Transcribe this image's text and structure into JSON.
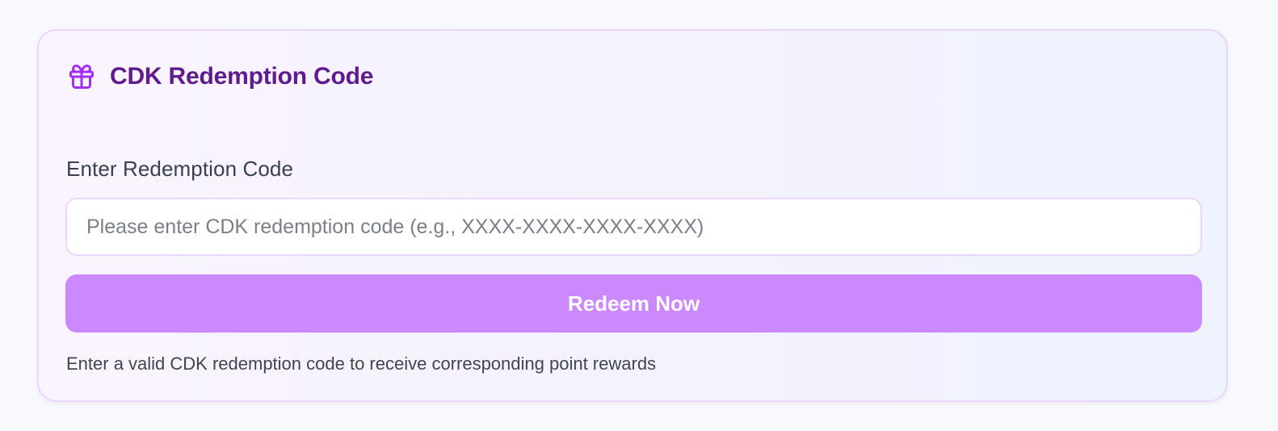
{
  "card": {
    "title": "CDK Redemption Code",
    "icon": "gift-icon",
    "accent_color": "#9b2ff0",
    "title_color": "#5f1a8c"
  },
  "form": {
    "label": "Enter Redemption Code",
    "input_value": "",
    "input_placeholder": "Please enter CDK redemption code (e.g., XXXX-XXXX-XXXX-XXXX)",
    "button_label": "Redeem Now",
    "button_color": "#cb89fd",
    "helper_text": "Enter a valid CDK redemption code to receive corresponding point rewards"
  }
}
